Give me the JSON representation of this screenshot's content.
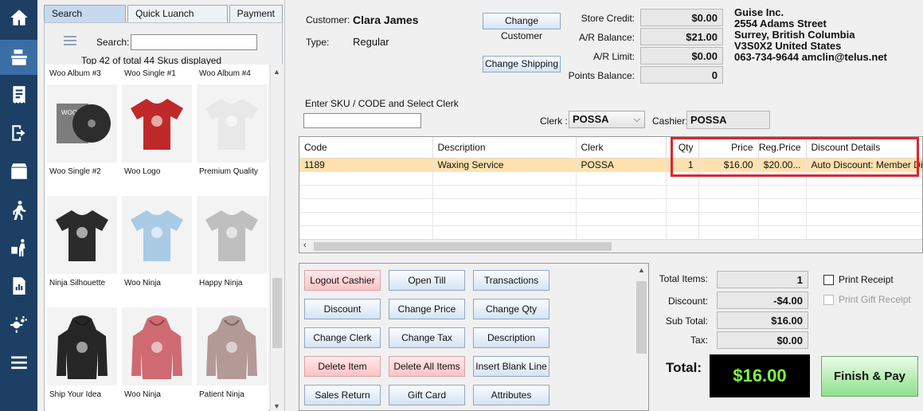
{
  "rail": {
    "items": [
      {
        "icon": "home-icon"
      },
      {
        "icon": "register-icon"
      },
      {
        "icon": "receipt-icon"
      },
      {
        "icon": "logout-icon"
      },
      {
        "icon": "store-icon"
      },
      {
        "icon": "walking-person-icon"
      },
      {
        "icon": "delivery-icon"
      },
      {
        "icon": "report-icon"
      },
      {
        "icon": "settings-icon"
      },
      {
        "icon": "menu-icon"
      }
    ]
  },
  "products": {
    "tabs": [
      "Search Products",
      "Quick Luanch Menus",
      "Payment"
    ],
    "search_label": "Search:",
    "search_value": "",
    "count_text": "Top 42 of total 44 Skus displayed",
    "top_labels": [
      "Woo Album #3",
      "Woo Single #1",
      "Woo Album #4"
    ],
    "rows": [
      [
        {
          "label": "Woo Single #2",
          "kind": "vinyl",
          "color": "#2d2d2d"
        },
        {
          "label": "Woo Logo",
          "kind": "tshirt",
          "color": "#c0292a"
        },
        {
          "label": "Premium Quality",
          "kind": "tshirt",
          "color": "#e8e8e8"
        }
      ],
      [
        {
          "label": "Ninja Silhouette",
          "kind": "tshirt",
          "color": "#2b2b2b"
        },
        {
          "label": "Woo Ninja",
          "kind": "tshirt",
          "color": "#a9cbe6"
        },
        {
          "label": "Happy Ninja",
          "kind": "tshirt",
          "color": "#bfbfbf"
        }
      ],
      [
        {
          "label": "Ship Your Idea",
          "kind": "hoodie",
          "color": "#262626"
        },
        {
          "label": "Woo Ninja",
          "kind": "hoodie",
          "color": "#cf6a72"
        },
        {
          "label": "Patient Ninja",
          "kind": "hoodie",
          "color": "#b39a97"
        }
      ]
    ]
  },
  "customer": {
    "customer_label": "Customer:",
    "customer_name": "Clara James",
    "type_label": "Type:",
    "type_value": "Regular",
    "change_customer": "Change Customer",
    "change_shipping": "Change Shipping"
  },
  "account": [
    {
      "label": "Store Credit:",
      "value": "$0.00"
    },
    {
      "label": "A/R Balance:",
      "value": "$21.00"
    },
    {
      "label": "A/R Limit:",
      "value": "$0.00"
    },
    {
      "label": "Points Balance:",
      "value": "0"
    }
  ],
  "company": {
    "name": "Guise Inc.",
    "street": "2554 Adams Street",
    "city": "Surrey, British Columbia",
    "postal": "V3S0X2 United States",
    "contact": "063-734-9644 amclin@telus.net"
  },
  "entry": {
    "group_label": "Enter SKU / CODE and Select Clerk",
    "sku_value": "",
    "clerk_label": "Clerk :",
    "clerk_value": "POSSA",
    "cashier_label": "Cashier:",
    "cashier_value": "POSSA"
  },
  "grid": {
    "columns": [
      "Code",
      "Description",
      "Clerk",
      "Qty",
      "Price",
      "Reg.Price",
      "Discount Details"
    ],
    "rows": [
      [
        "1189",
        "Waxing Service",
        "POSSA",
        "1",
        "$16.00",
        "$20.00...",
        "Auto Discount: Member Discount"
      ]
    ],
    "empty_rows": 5
  },
  "buttons": [
    [
      "Logout Cashier",
      "Open Till",
      "Transactions"
    ],
    [
      "Discount",
      "Change Price",
      "Change Qty"
    ],
    [
      "Change Clerk",
      "Change Tax",
      "Description"
    ],
    [
      "Delete Item",
      "Delete All Items",
      "Insert Blank Line"
    ],
    [
      "Sales Return",
      "Gift Card",
      "Attributes"
    ]
  ],
  "red_buttons": [
    "Logout Cashier",
    "Delete Item",
    "Delete All Items"
  ],
  "totals": [
    {
      "label": "Total Items:",
      "value": "1"
    },
    {
      "label": "Discount:",
      "value": "-$4.00"
    },
    {
      "label": "Sub Total:",
      "value": "$16.00"
    },
    {
      "label": "Tax:",
      "value": "$0.00"
    }
  ],
  "total": {
    "label": "Total:",
    "value": "$16.00"
  },
  "finish_label": "Finish & Pay",
  "print_receipt": {
    "label": "Print Receipt",
    "checked": false
  },
  "print_gift_receipt": {
    "label": "Print Gift Receipt",
    "checked": false,
    "disabled": true
  },
  "colors": {
    "rail": "#1c3f63",
    "selected_row": "#ffe1ad",
    "highlight_box": "#e0242c",
    "total_text": "#7cff3a"
  }
}
